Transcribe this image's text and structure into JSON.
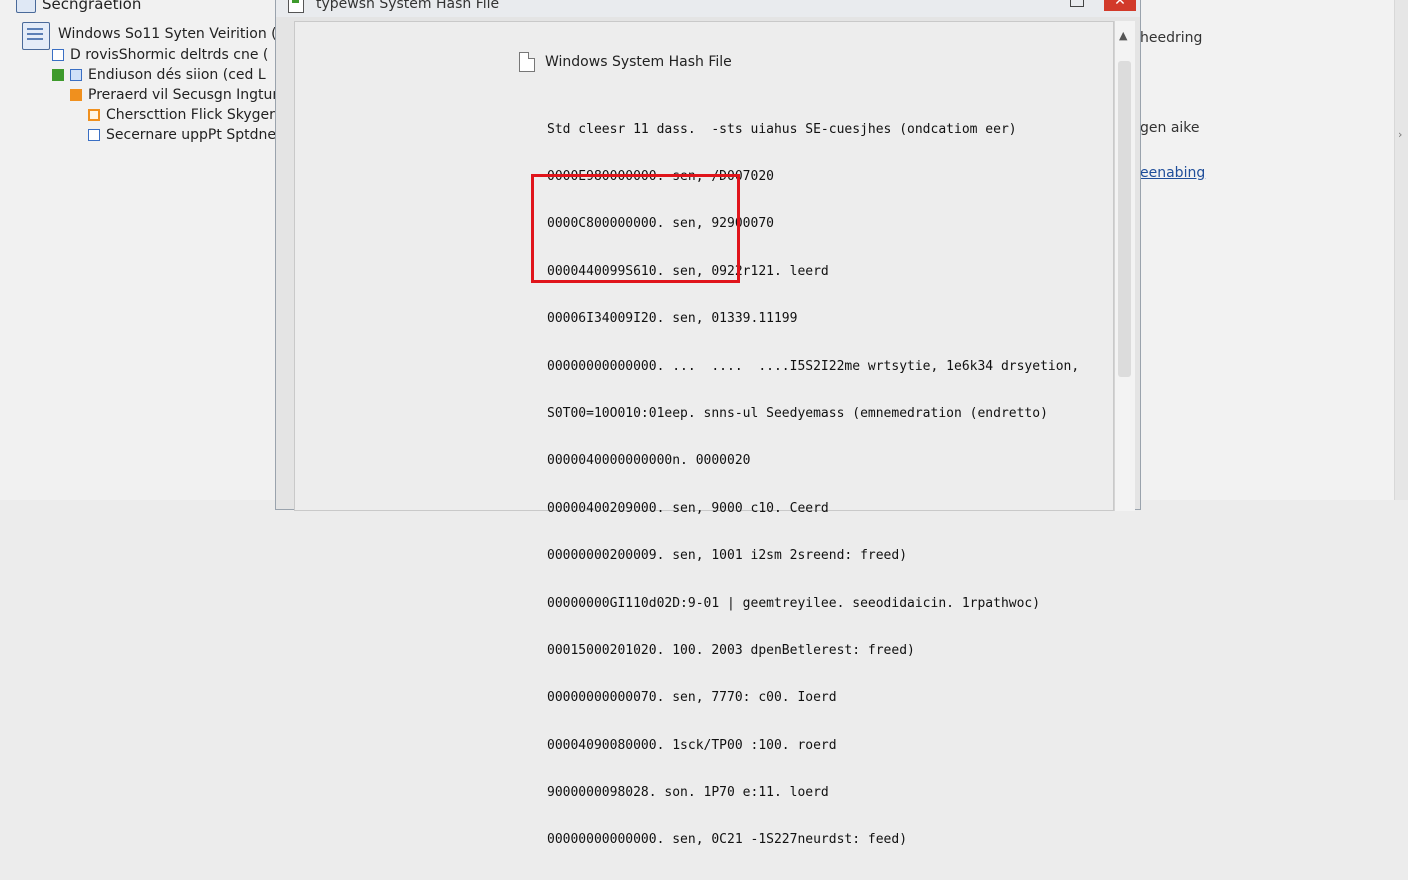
{
  "tree": {
    "header": "Secngraetion",
    "items": [
      {
        "label": "Windows So11 Syten Veirition (",
        "icon": "database-icon"
      },
      {
        "label": "D rovisShormic deltrds cne (",
        "icon": "blue-square-icon"
      },
      {
        "label": "Endiuson dés siion (ced L",
        "icon": "green-square-icon"
      },
      {
        "label": "Preraerd vil Secusgn Ingtur",
        "icon": "orange-square-icon"
      },
      {
        "label": "Cherscttion Flick Skyger",
        "icon": "orange-outline-square-icon"
      },
      {
        "label": "Secernare uppPt Sptdne",
        "icon": "blue-outline-square-icon"
      }
    ]
  },
  "window": {
    "title": "typewsn System Hash File",
    "close_glyph": "✕",
    "document_title": "Windows System Hash File",
    "lines": [
      "Std cleesr 11 dass.  -sts uiahus SE-cuesjhes (ondcatiom eer)",
      "0000E980000000. sen, /D007020",
      "0000C800000000. sen, 92900070",
      "0000440099S610. sen, 0922r121. leerd",
      "00006I34009I20. sen, 01339.11199",
      "00000000000000. ...  ....  ....I5S2I22me wrtsytie, 1e6k34 drsyetion,",
      "S0T00=10O010:01eep. snns-ul Seedyemass (emnemedration (endretto)",
      "0000040000000000n. 0000020",
      "00000400209000. sen, 9000 c10. Ceerd",
      "00000000200009. sen, 1001 i2sm 2sreend: freed)",
      "00000000GI110d02D:9-01 | geemtreyilee. seeodidaicin. 1rpathwoc)",
      "00015000201020. 100. 2003 dpenBetlerest: freed)",
      "00000000000070. sen, 7770: c00. Ioerd",
      "00004090080000. 1sck/TP00 :100. roerd",
      "9000000098028. son. 1P70 e:11. loerd",
      "00000000000000. sen, 0C21 -1S227neurdst: feed)"
    ]
  },
  "right_panel": {
    "text1": "heedring",
    "text2": "gen aike",
    "link": "eenabing"
  },
  "colors": {
    "highlight": "#e0151b",
    "accent_blue": "#3a6fc4",
    "green": "#3e9a2c",
    "orange": "#f0901e"
  }
}
